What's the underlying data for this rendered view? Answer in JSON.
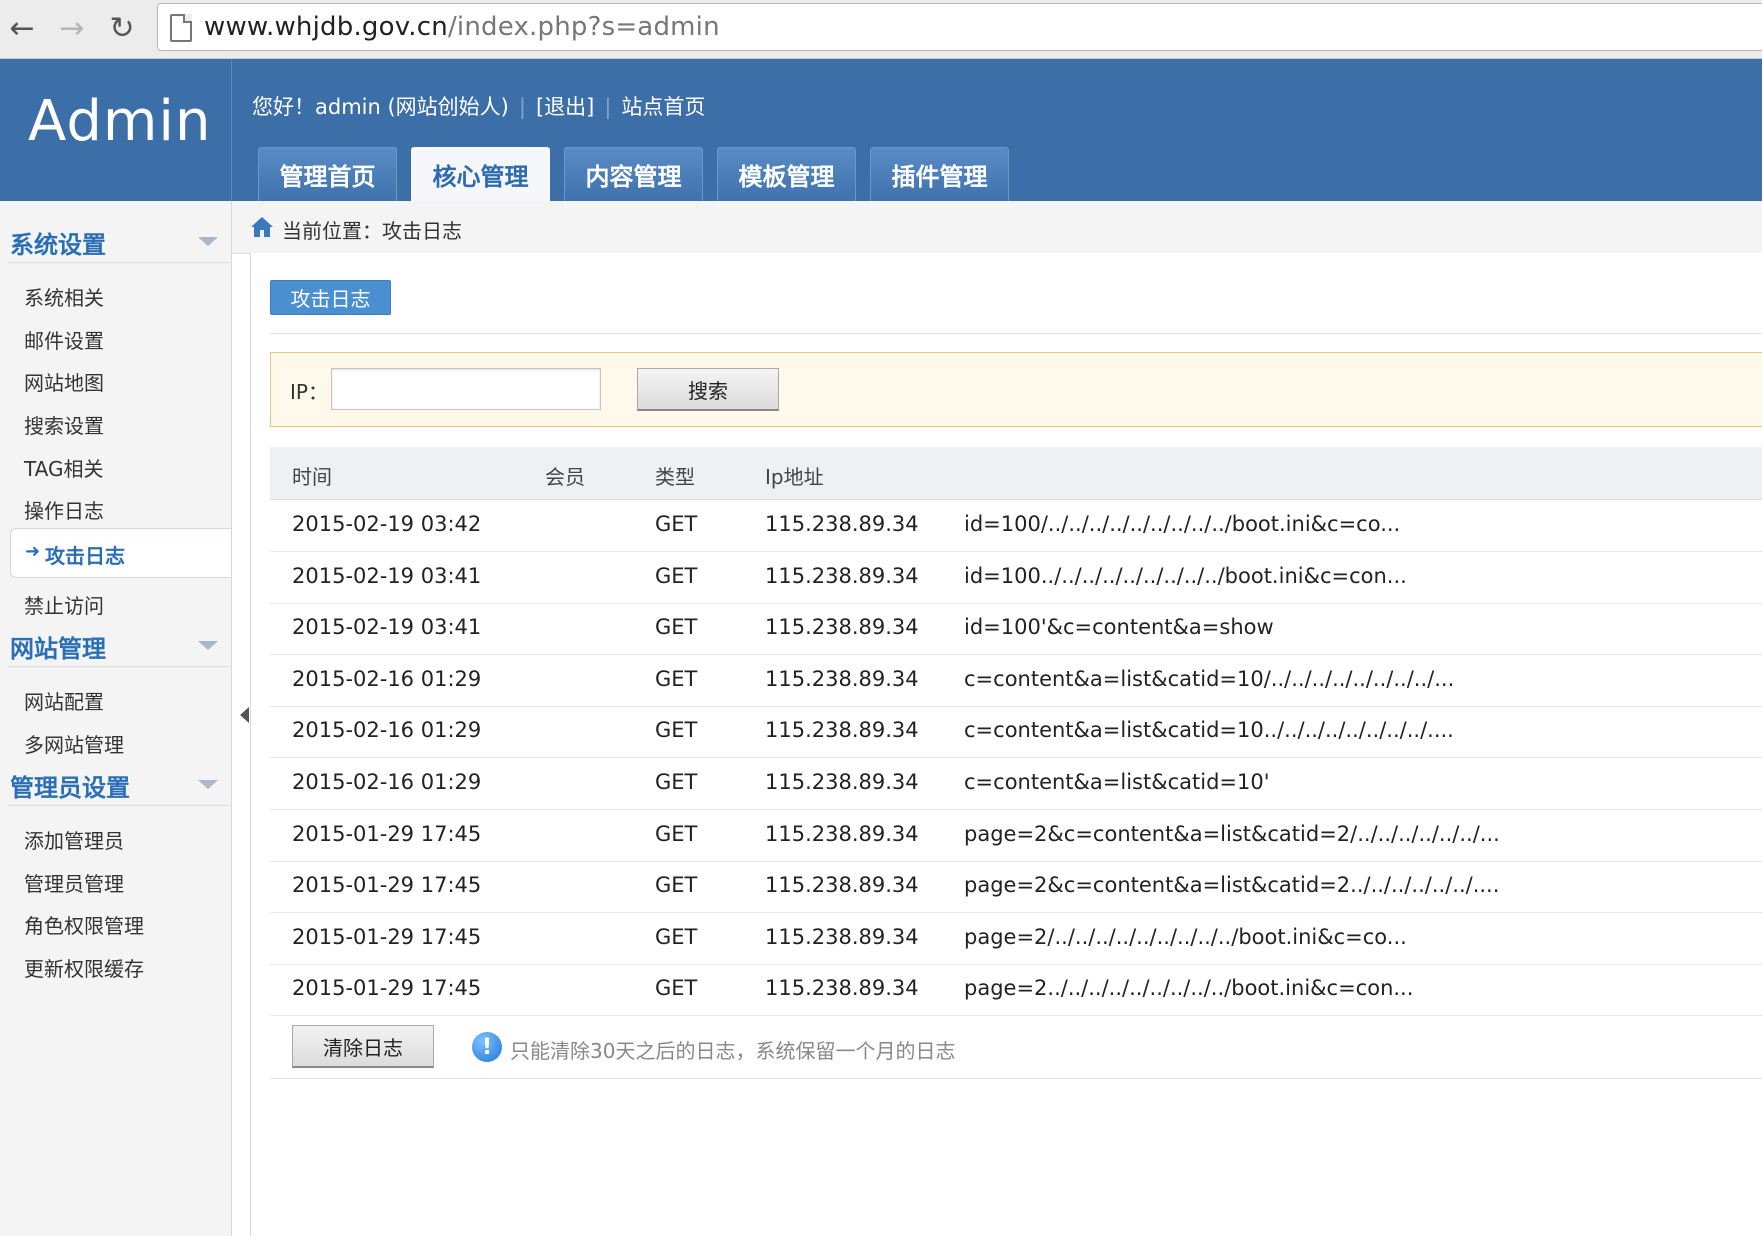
{
  "browser": {
    "url_host": "www.whjdb.gov.cn",
    "url_rest": "/index.php?s=admin"
  },
  "header": {
    "logo": "Admin",
    "greeting": "您好！admin (网站创始人)",
    "logout": "[退出]",
    "site_home": "站点首页",
    "tabs": [
      "管理首页",
      "核心管理",
      "内容管理",
      "模板管理",
      "插件管理"
    ],
    "active_tab": "核心管理"
  },
  "sidebar": {
    "sections": [
      {
        "title": "系统设置",
        "items": [
          "系统相关",
          "邮件设置",
          "网站地图",
          "搜索设置",
          "TAG相关",
          "操作日志",
          "攻击日志",
          "禁止访问"
        ]
      },
      {
        "title": "网站管理",
        "items": [
          "网站配置",
          "多网站管理"
        ]
      },
      {
        "title": "管理员设置",
        "items": [
          "添加管理员",
          "管理员管理",
          "角色权限管理",
          "更新权限缓存"
        ]
      }
    ],
    "active_item": "攻击日志"
  },
  "breadcrumb": "当前位置：攻击日志",
  "sub_tab": "攻击日志",
  "search": {
    "label": "IP：",
    "input_value": "",
    "button": "搜索"
  },
  "table": {
    "headers": [
      "时间",
      "会员",
      "类型",
      "Ip地址",
      ""
    ],
    "rows": [
      {
        "time": "2015-02-19 03:42",
        "member": "",
        "type": "GET",
        "ip": "115.238.89.34",
        "query": "id=100/../../../../../../../../../boot.ini&c=co..."
      },
      {
        "time": "2015-02-19 03:41",
        "member": "",
        "type": "GET",
        "ip": "115.238.89.34",
        "query": "id=100../../../../../../../../../boot.ini&c=con..."
      },
      {
        "time": "2015-02-19 03:41",
        "member": "",
        "type": "GET",
        "ip": "115.238.89.34",
        "query": "id=100'&c=content&a=show"
      },
      {
        "time": "2015-02-16 01:29",
        "member": "",
        "type": "GET",
        "ip": "115.238.89.34",
        "query": "c=content&a=list&catid=10/../../../../../../../../..."
      },
      {
        "time": "2015-02-16 01:29",
        "member": "",
        "type": "GET",
        "ip": "115.238.89.34",
        "query": "c=content&a=list&catid=10../../../../../../../../...."
      },
      {
        "time": "2015-02-16 01:29",
        "member": "",
        "type": "GET",
        "ip": "115.238.89.34",
        "query": "c=content&a=list&catid=10'"
      },
      {
        "time": "2015-01-29 17:45",
        "member": "",
        "type": "GET",
        "ip": "115.238.89.34",
        "query": "page=2&c=content&a=list&catid=2/../../../../../../..."
      },
      {
        "time": "2015-01-29 17:45",
        "member": "",
        "type": "GET",
        "ip": "115.238.89.34",
        "query": "page=2&c=content&a=list&catid=2../../../../../../...."
      },
      {
        "time": "2015-01-29 17:45",
        "member": "",
        "type": "GET",
        "ip": "115.238.89.34",
        "query": "page=2/../../../../../../../../../boot.ini&c=co..."
      },
      {
        "time": "2015-01-29 17:45",
        "member": "",
        "type": "GET",
        "ip": "115.238.89.34",
        "query": "page=2../../../../../../../../../boot.ini&c=con..."
      }
    ]
  },
  "footer": {
    "clear_button": "清除日志",
    "info_text": "只能清除30天之后的日志，系统保留一个月的日志"
  },
  "colors": {
    "header_bg": "#3c6ea8",
    "accent": "#2a6fb6",
    "search_bg": "#fff9ec",
    "search_border": "#f0c47a"
  }
}
